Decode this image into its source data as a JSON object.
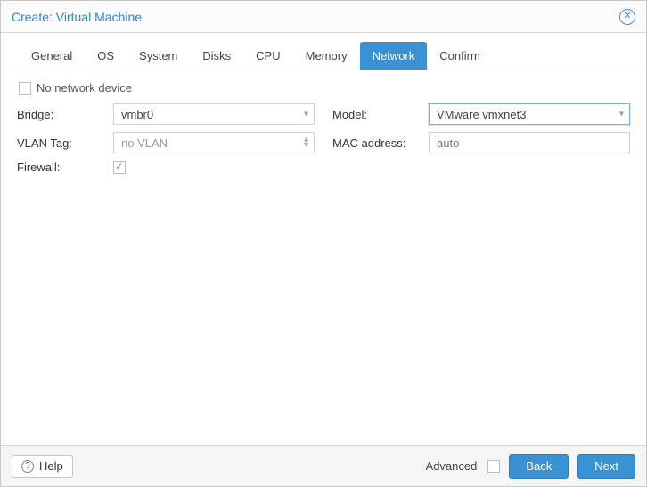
{
  "title": "Create: Virtual Machine",
  "tabs": [
    {
      "label": "General"
    },
    {
      "label": "OS"
    },
    {
      "label": "System"
    },
    {
      "label": "Disks"
    },
    {
      "label": "CPU"
    },
    {
      "label": "Memory"
    },
    {
      "label": "Network",
      "active": true
    },
    {
      "label": "Confirm"
    }
  ],
  "no_network_label": "No network device",
  "left": {
    "bridge": {
      "label": "Bridge:",
      "value": "vmbr0"
    },
    "vlan": {
      "label": "VLAN Tag:",
      "placeholder": "no VLAN"
    },
    "firewall": {
      "label": "Firewall:"
    }
  },
  "right": {
    "model": {
      "label": "Model:",
      "value": "VMware vmxnet3"
    },
    "mac": {
      "label": "MAC address:",
      "placeholder": "auto"
    }
  },
  "footer": {
    "help": "Help",
    "advanced": "Advanced",
    "back": "Back",
    "next": "Next"
  }
}
